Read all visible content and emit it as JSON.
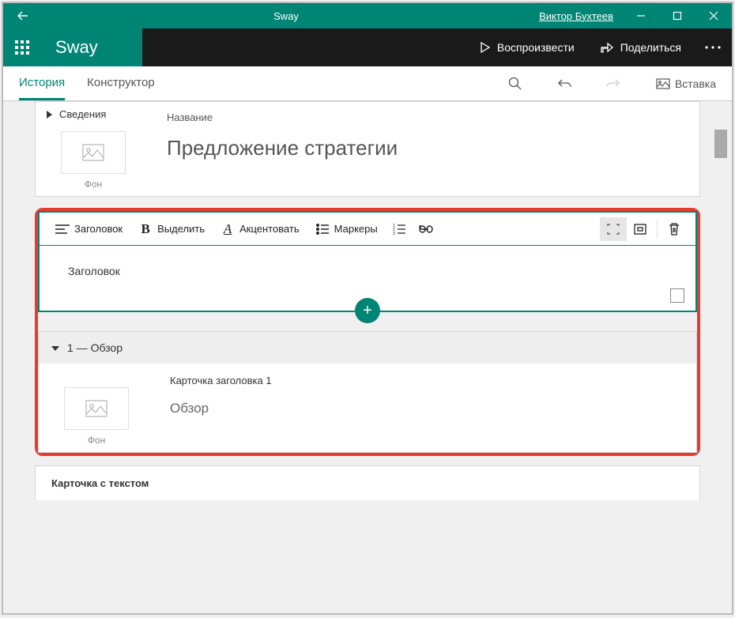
{
  "titlebar": {
    "app_title": "Sway",
    "user_name": "Виктор Бухтеев"
  },
  "appbar": {
    "brand": "Sway",
    "play_label": "Воспроизвести",
    "share_label": "Поделиться"
  },
  "tabs": {
    "history": "История",
    "designer": "Конструктор",
    "insert": "Вставка"
  },
  "title_card": {
    "details_label": "Сведения",
    "bg_label": "Фон",
    "field_label": "Название",
    "title_text": "Предложение стратегии"
  },
  "editor": {
    "toolbar": {
      "heading": "Заголовок",
      "emphasize": "Выделить",
      "accent": "Акцентовать",
      "bullets": "Маркеры"
    },
    "content_text": "Заголовок"
  },
  "section": {
    "head_label": "1 — Обзор",
    "bg_label": "Фон",
    "card_label": "Карточка заголовка 1",
    "title_text": "Обзор"
  },
  "trail": {
    "label": "Карточка с текстом"
  }
}
